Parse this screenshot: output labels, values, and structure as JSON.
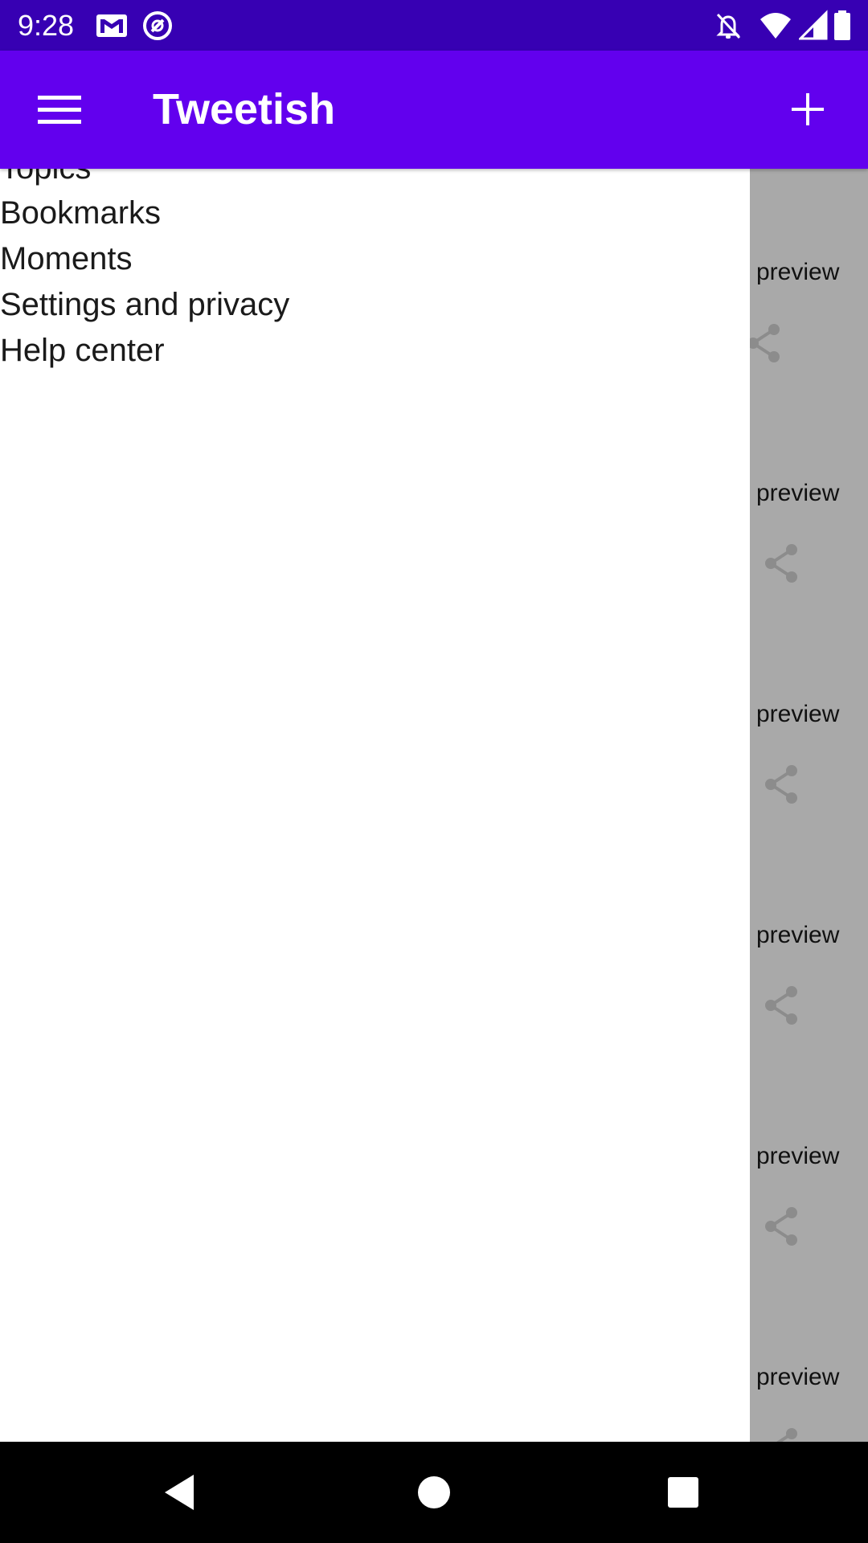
{
  "status_bar": {
    "time": "9:28",
    "icons": [
      "gmail-icon",
      "at-sign-icon",
      "notifications-off-icon",
      "wifi-icon",
      "signal-icon",
      "battery-icon"
    ]
  },
  "app_bar": {
    "title": "Tweetish",
    "menu_icon": "hamburger-menu-icon",
    "add_icon": "plus-icon"
  },
  "drawer": {
    "items": [
      {
        "label": "Topics"
      },
      {
        "label": "Bookmarks"
      },
      {
        "label": "Moments"
      },
      {
        "label": "Settings and privacy"
      },
      {
        "label": "Help center"
      }
    ]
  },
  "feed_behind": {
    "items": [
      {
        "label": "preview"
      },
      {
        "label": "preview"
      },
      {
        "label": "preview"
      },
      {
        "label": "preview"
      },
      {
        "label": "preview"
      },
      {
        "label": "preview"
      }
    ]
  },
  "nav_bar": {
    "back_icon": "back-triangle-icon",
    "home_icon": "home-circle-icon",
    "recents_icon": "recents-square-icon"
  },
  "colors": {
    "status_bar": "#3700b3",
    "app_bar": "#6200ee",
    "scrim": "#a9a9a9",
    "share_icon": "#8c8c8c"
  }
}
